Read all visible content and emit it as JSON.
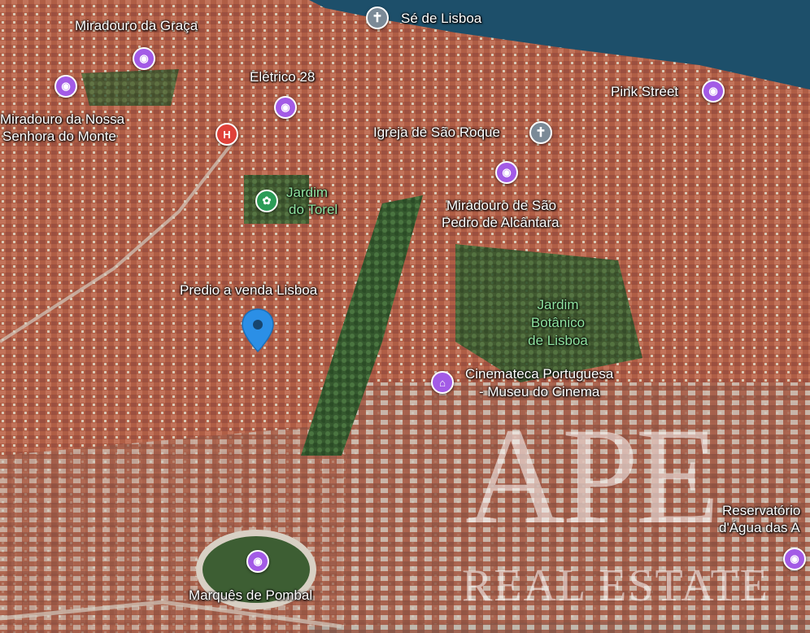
{
  "map": {
    "colors": {
      "water": "#1d4f6a",
      "roof": "#b5634a",
      "park": "#3f6a35",
      "road": "#c9c3b8"
    },
    "labels": {
      "se": "Sé de Lisboa",
      "graca": "Miradouro da Graça",
      "eletrico": "Elétrico 28",
      "nossa1": "Miradouro da Nossa",
      "nossa2": "Senhora do Monte",
      "pink": "Pink Street",
      "roque": "Igreja de São Roque",
      "torel1": "Jardim",
      "torel2": "do Torel",
      "pedro1": "Miradouro de São",
      "pedro2": "Pedro de Alcântara",
      "predio": "Predio a venda Lisboa",
      "botanico1": "Jardim",
      "botanico2": "Botânico",
      "botanico3": "de Lisboa",
      "cine1": "Cinemateca Portuguesa",
      "cine2": "- Museu do Cinema",
      "reserva1": "Reservatório",
      "reserva2": "d'Água das A",
      "pombal": "Marquês de Pombal"
    },
    "icons": {
      "photo": "camera-icon",
      "church": "church-icon",
      "park": "park-icon",
      "hospital": "hospital-icon",
      "museum": "museum-icon",
      "marker": "location-marker-icon"
    },
    "pin_glyphs": {
      "photo": "◉",
      "church": "✝",
      "park": "✿",
      "hospital": "H",
      "museum": "⌂"
    }
  },
  "watermark": {
    "logo": "APE",
    "tagline": "REAL ESTATE"
  }
}
